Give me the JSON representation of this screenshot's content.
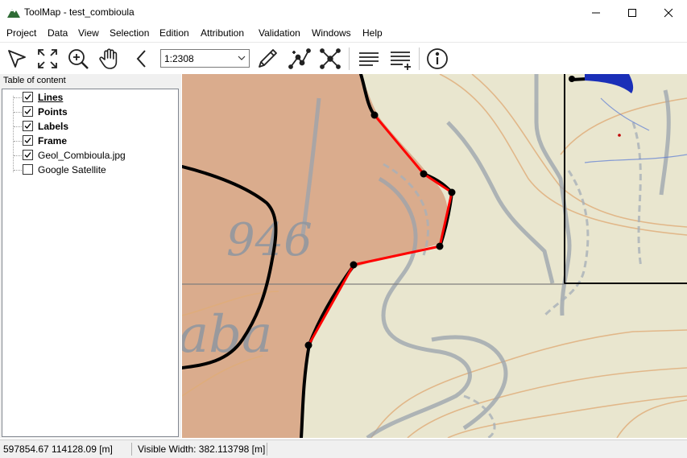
{
  "window": {
    "title": "ToolMap - test_combioula",
    "icon": "mountain-app-icon"
  },
  "menu": [
    "Project",
    "Data",
    "View",
    "Selection",
    "Edition",
    "Attribution",
    "Validation",
    "Windows",
    "Help"
  ],
  "toolbar": {
    "tools": [
      "select-arrow-icon",
      "zoom-extent-icon",
      "zoom-in-icon",
      "pan-hand-icon",
      "previous-zoom-icon",
      "draw-pencil-icon",
      "modify-vertex-icon",
      "cut-lines-icon",
      "attribution-list-icon",
      "attribution-add-icon",
      "info-icon"
    ],
    "scale_value": "1:2308"
  },
  "toc": {
    "header": "Table of content",
    "layers": [
      {
        "label": "Lines",
        "checked": true,
        "bold": true,
        "underline": true
      },
      {
        "label": "Points",
        "checked": true,
        "bold": true,
        "underline": false
      },
      {
        "label": "Labels",
        "checked": true,
        "bold": true,
        "underline": false
      },
      {
        "label": "Frame",
        "checked": true,
        "bold": true,
        "underline": false
      },
      {
        "label": "Geol_Combioula.jpg",
        "checked": true,
        "bold": false,
        "underline": false
      },
      {
        "label": "Google Satellite",
        "checked": false,
        "bold": false,
        "underline": false
      }
    ]
  },
  "map": {
    "printed_labels": [
      "946",
      "aba"
    ],
    "colors": {
      "background": "#e9e6cf",
      "geology_fill": "#d8a788",
      "selected_line": "#ff0000",
      "line": "#000000"
    }
  },
  "status": {
    "coordinates": "597854.67 114128.09 [m]",
    "visible_width": "Visible Width: 382.113798 [m]"
  }
}
